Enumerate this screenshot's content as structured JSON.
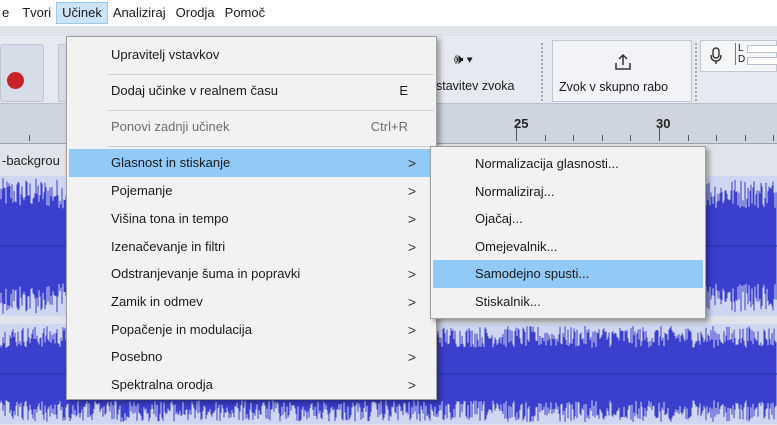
{
  "menubar": {
    "items": [
      "e",
      "Tvori",
      "Učinek",
      "Analiziraj",
      "Orodja",
      "Pomoč"
    ]
  },
  "toolbar": {
    "audio_setup_label": "stavitev zvoka",
    "share_audio_label": "Zvok v skupno rabo",
    "meter_lr": [
      "L",
      "D"
    ]
  },
  "ruler": {
    "labels": [
      "25",
      "30"
    ]
  },
  "track": {
    "name": "-backgrou"
  },
  "effect_menu": {
    "items": [
      {
        "label": "Upravitelj vstavkov"
      },
      {
        "label": "Dodaj učinke v realnem času",
        "shortcut": "E"
      },
      {
        "label": "Ponovi zadnji učinek",
        "shortcut": "Ctrl+R",
        "disabled": true
      },
      {
        "label": "Glasnost in stiskanje",
        "submenu": true,
        "highlighted": true
      },
      {
        "label": "Pojemanje",
        "submenu": true
      },
      {
        "label": "Višina tona in tempo",
        "submenu": true
      },
      {
        "label": "Izenačevanje in filtri",
        "submenu": true
      },
      {
        "label": "Odstranjevanje šuma in popravki",
        "submenu": true
      },
      {
        "label": "Zamik in odmev",
        "submenu": true
      },
      {
        "label": "Popačenje in modulacija",
        "submenu": true
      },
      {
        "label": "Posebno",
        "submenu": true
      },
      {
        "label": "Spektralna orodja",
        "submenu": true
      }
    ],
    "submenu_arrow": ">"
  },
  "volume_submenu": {
    "items": [
      {
        "label": "Normalizacija glasnosti..."
      },
      {
        "label": "Normaliziraj..."
      },
      {
        "label": "Ojačaj..."
      },
      {
        "label": "Omejevalnik..."
      },
      {
        "label": "Samodejno spusti...",
        "highlighted": true
      },
      {
        "label": "Stiskalnik..."
      }
    ]
  },
  "colors": {
    "waveform": "#3b3fce",
    "waveform_bg": "#cfd6f2",
    "highlight": "#91c9f7",
    "record": "#c9232a"
  }
}
